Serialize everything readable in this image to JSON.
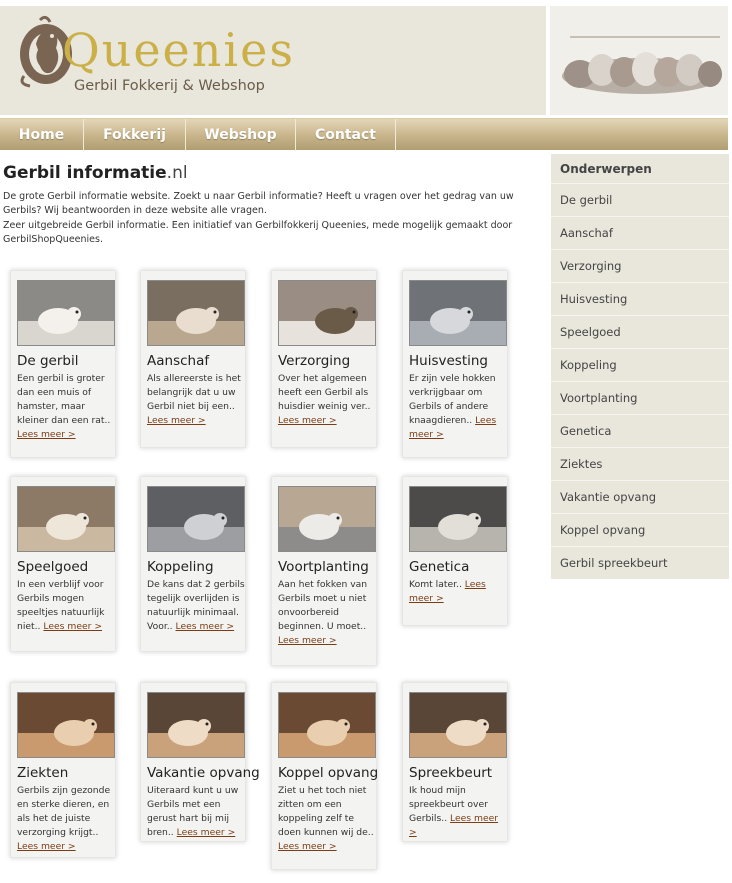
{
  "header": {
    "logo_word": "Queenies",
    "logo_sub": "Gerbil Fokkerij & Webshop"
  },
  "nav": [
    "Home",
    "Fokkerij",
    "Webshop",
    "Contact"
  ],
  "page": {
    "title": "Gerbil informatie",
    "title_suffix": ".nl",
    "intro_1": "De grote Gerbil informatie website. Zoekt u naar Gerbil informatie? Heeft u vragen over het gedrag van uw Gerbils? Wij beantwoorden in deze website alle vragen.",
    "intro_2": "Zeer uitgebreide Gerbil informatie. Een initiatief van Gerbilfokkerij Queenies, mede mogelijk gemaakt door GerbilShopQueenies."
  },
  "more_link": "Lees meer >",
  "cards": [
    {
      "title": "De gerbil",
      "text": "Een gerbil is groter dan een muis of hamster, maar kleiner dan een rat.."
    },
    {
      "title": "Aanschaf",
      "text": "Als allereerste is het belangrijk dat u uw Gerbil niet bij een.."
    },
    {
      "title": "Verzorging",
      "text": "Over het algemeen heeft een Gerbil als huisdier weinig ver.."
    },
    {
      "title": "Huisvesting",
      "text": "Er zijn vele hokken verkrijgbaar om Gerbils of andere knaagdieren.."
    },
    {
      "title": "Speelgoed",
      "text": "In een verblijf voor Gerbils mogen speeltjes natuurlijk niet.."
    },
    {
      "title": "Koppeling",
      "text": "De kans dat 2 gerbils tegelijk overlijden is natuurlijk minimaal. Voor.."
    },
    {
      "title": "Voortplanting",
      "text": "Aan het fokken van Gerbils moet u niet onvoorbereid beginnen. U moet.."
    },
    {
      "title": "Genetica",
      "text": "Komt later.."
    },
    {
      "title": "Ziekten",
      "text": "Gerbils zijn gezonde en sterke dieren, en als het de juiste verzorging krijgt.."
    },
    {
      "title": "Vakantie opvang",
      "text": "Uiteraard kunt u uw Gerbils met een gerust hart bij mij bren.."
    },
    {
      "title": "Koppel opvang",
      "text": "Ziet u het toch niet zitten om een koppeling zelf te doen kunnen wij de.."
    },
    {
      "title": "Spreekbeurt",
      "text": "Ik houd mijn spreekbeurt over Gerbils.."
    }
  ],
  "sidebar": {
    "heading": "Onderwerpen",
    "items": [
      "De gerbil",
      "Aanschaf",
      "Verzorging",
      "Huisvesting",
      "Speelgoed",
      "Koppeling",
      "Voortplanting",
      "Genetica",
      "Ziektes",
      "Vakantie opvang",
      "Koppel opvang",
      "Gerbil spreekbeurt"
    ]
  },
  "colors": {
    "logo_gold": "#cbb048",
    "nav_tan": "#c8b48a",
    "panel_beige": "#e9e6dc",
    "link_brown": "#7b3d16"
  }
}
